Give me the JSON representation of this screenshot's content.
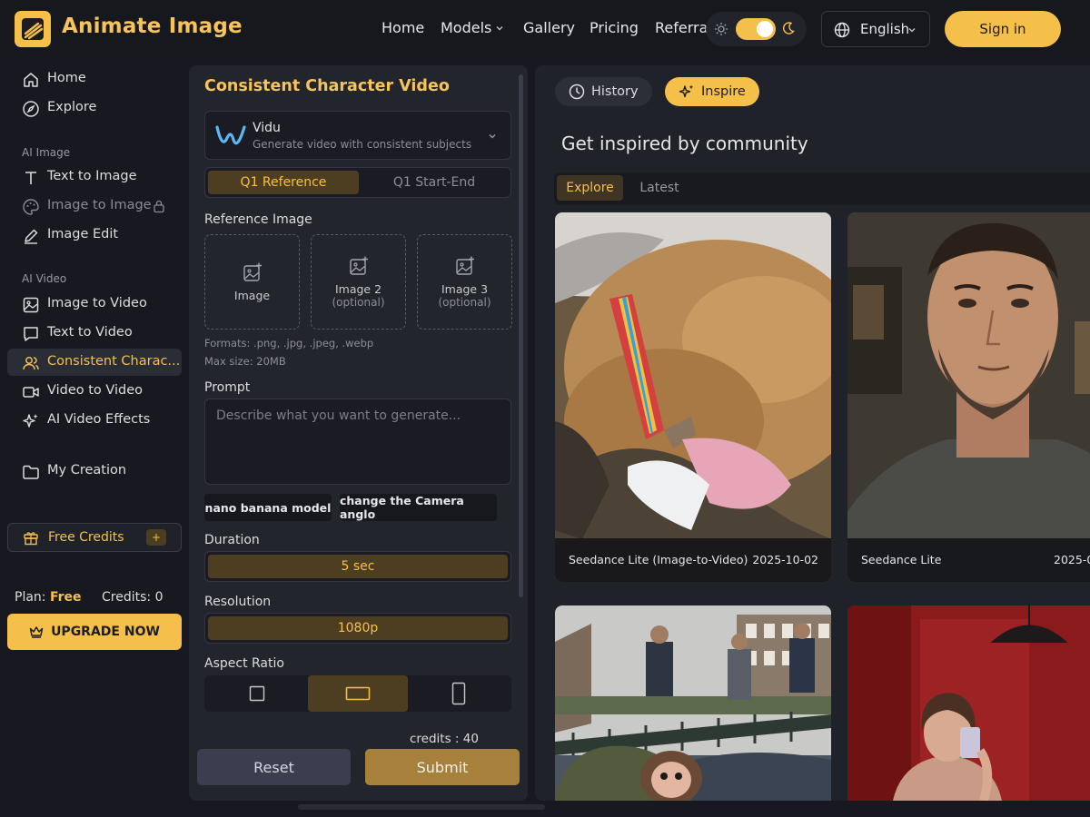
{
  "header": {
    "brand": "Animate Image",
    "nav": {
      "home": "Home",
      "models": "Models",
      "gallery": "Gallery",
      "pricing": "Pricing",
      "referral": "Referral"
    },
    "language": "English",
    "sign_in": "Sign in",
    "accent_color": "#f5c04a"
  },
  "sidebar": {
    "home": "Home",
    "explore": "Explore",
    "section_ai_image": "AI Image",
    "text_to_image": "Text to Image",
    "image_to_image": "Image to Image",
    "image_edit": "Image Edit",
    "section_ai_video": "AI Video",
    "image_to_video": "Image to Video",
    "text_to_video": "Text to Video",
    "consistent_character": "Consistent Charac...",
    "video_to_video": "Video to Video",
    "ai_video_effects": "AI Video Effects",
    "my_creation": "My Creation",
    "free_credits": "Free Credits",
    "free_credits_plus": "+",
    "plan_label": "Plan:",
    "plan_value": "Free",
    "credits_label": "Credits:",
    "credits_value": "0",
    "upgrade": "UPGRADE NOW"
  },
  "form": {
    "title": "Consistent Character Video",
    "model_name": "Vidu",
    "model_desc": "Generate video with consistent subjects",
    "mode_options": [
      "Q1 Reference",
      "Q1 Start-End"
    ],
    "mode_selected": "Q1 Reference",
    "reference_label": "Reference Image",
    "slots": [
      {
        "label": "Image",
        "sub": ""
      },
      {
        "label": "Image 2",
        "sub": "(optional)"
      },
      {
        "label": "Image 3",
        "sub": "(optional)"
      }
    ],
    "formats": "Formats: .png, .jpg, .jpeg, .webp",
    "max_size": "Max size: 20MB",
    "prompt_label": "Prompt",
    "prompt_placeholder": "Describe what you want to generate...",
    "chips": [
      "nano banana model",
      "change the Camera anglo"
    ],
    "duration_label": "Duration",
    "duration_value": "5 sec",
    "resolution_label": "Resolution",
    "resolution_value": "1080p",
    "aspect_label": "Aspect Ratio",
    "aspect_selected": "landscape",
    "credits_cost": "credits : 40",
    "reset": "Reset",
    "submit": "Submit"
  },
  "inspire": {
    "history": "History",
    "inspire": "Inspire",
    "title": "Get inspired by community",
    "tabs": [
      "Explore",
      "Latest"
    ],
    "tab_selected": "Explore",
    "cards": [
      {
        "model": "Seedance Lite (Image-to-Video)",
        "date": "2025-10-02"
      },
      {
        "model": "Seedance Lite",
        "date": "2025-0"
      },
      {
        "model": "",
        "date": ""
      },
      {
        "model": "",
        "date": ""
      }
    ]
  }
}
